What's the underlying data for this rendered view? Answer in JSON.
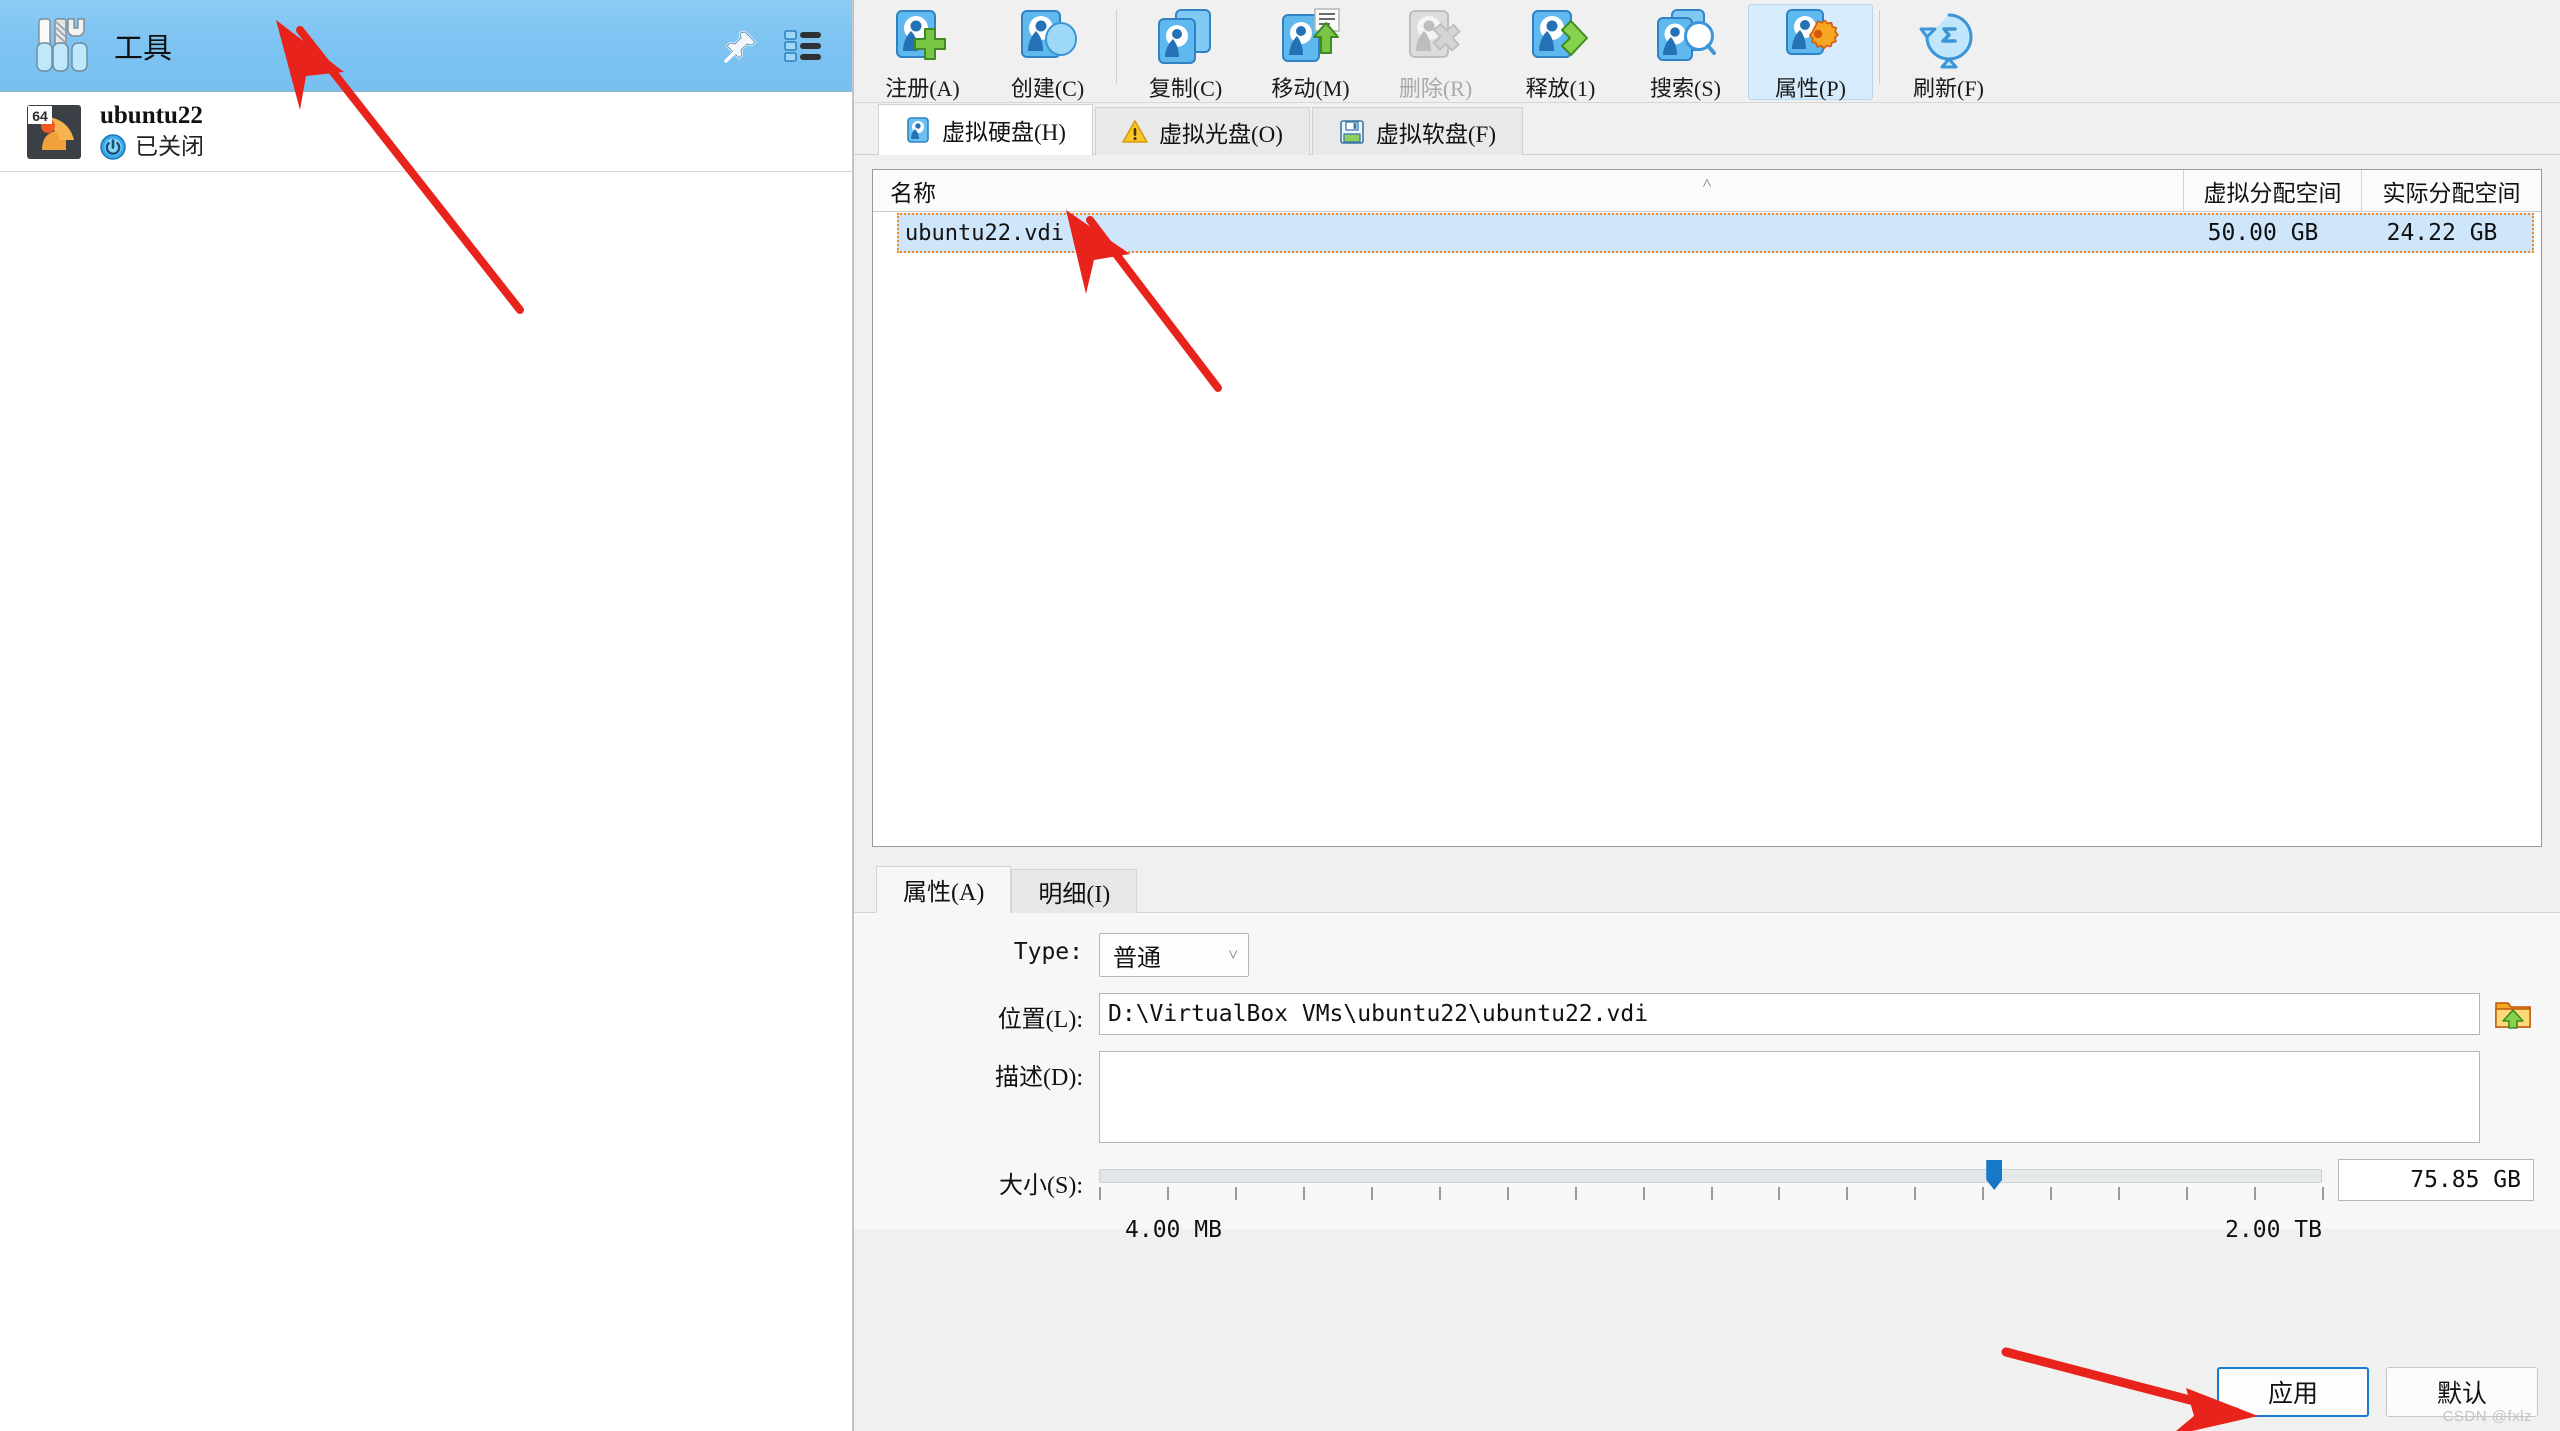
{
  "sidebar": {
    "tools": {
      "label": "工具",
      "icon": "tools-icon"
    },
    "pin_icon": "pin-icon",
    "list_icon": "list-view-icon",
    "machines": [
      {
        "name": "ubuntu22",
        "state": "已关闭",
        "arch_badge": "64",
        "icon": "ubuntu-vm-icon",
        "state_icon": "power-off-icon"
      }
    ]
  },
  "toolbar": {
    "items": [
      {
        "label": "注册(A)",
        "icon": "disk-add-icon",
        "disabled": false,
        "active": false
      },
      {
        "label": "创建(C)",
        "icon": "disk-create-icon",
        "disabled": false,
        "active": false
      },
      {
        "label": "复制(C)",
        "icon": "disk-copy-icon",
        "disabled": false,
        "active": false
      },
      {
        "label": "移动(M)",
        "icon": "disk-move-icon",
        "disabled": false,
        "active": false
      },
      {
        "label": "删除(R)",
        "icon": "disk-remove-icon",
        "disabled": true,
        "active": false
      },
      {
        "label": "释放(1)",
        "icon": "disk-release-icon",
        "disabled": false,
        "active": false
      },
      {
        "label": "搜索(S)",
        "icon": "disk-search-icon",
        "disabled": false,
        "active": false
      },
      {
        "label": "属性(P)",
        "icon": "disk-properties-icon",
        "disabled": false,
        "active": true
      },
      {
        "label": "刷新(F)",
        "icon": "refresh-icon",
        "disabled": false,
        "active": false
      }
    ]
  },
  "media_tabs": [
    {
      "label": "虚拟硬盘(H)",
      "icon": "hard-disk-icon",
      "active": true
    },
    {
      "label": "虚拟光盘(O)",
      "icon": "warning-icon",
      "active": false
    },
    {
      "label": "虚拟软盘(F)",
      "icon": "floppy-icon",
      "active": false
    }
  ],
  "table": {
    "columns": [
      "名称",
      "虚拟分配空间",
      "实际分配空间"
    ],
    "sort_indicator": "˄",
    "rows": [
      {
        "name": "ubuntu22.vdi",
        "virtual_size": "50.00 GB",
        "actual_size": "24.22 GB",
        "selected": true
      }
    ]
  },
  "properties": {
    "tabs": [
      {
        "label": "属性(A)",
        "active": true
      },
      {
        "label": "明细(I)",
        "active": false
      }
    ],
    "type": {
      "label": "Type:",
      "value": "普通",
      "chevron": "˅"
    },
    "location": {
      "label": "位置(L):",
      "value": "D:\\VirtualBox VMs\\ubuntu22\\ubuntu22.vdi",
      "browse_icon": "folder-open-icon"
    },
    "description": {
      "label": "描述(D):",
      "value": ""
    },
    "size": {
      "label": "大小(S):",
      "value": "75.85 GB",
      "min": "4.00 MB",
      "max": "2.00 TB",
      "thumb_percent": 73.2,
      "tick_count": 19
    }
  },
  "footer": {
    "apply_label": "应用",
    "reset_label": "默认"
  },
  "watermark": "CSDN @fxlz",
  "colors": {
    "selection_blue": "#7cc3f2",
    "row_highlight": "#cfe6fa",
    "focus_dotted": "#f08a1e",
    "accent_blue": "#1a7ad4",
    "annotation_red": "#e8231b",
    "toolbar_active": "#d6ebfb"
  }
}
